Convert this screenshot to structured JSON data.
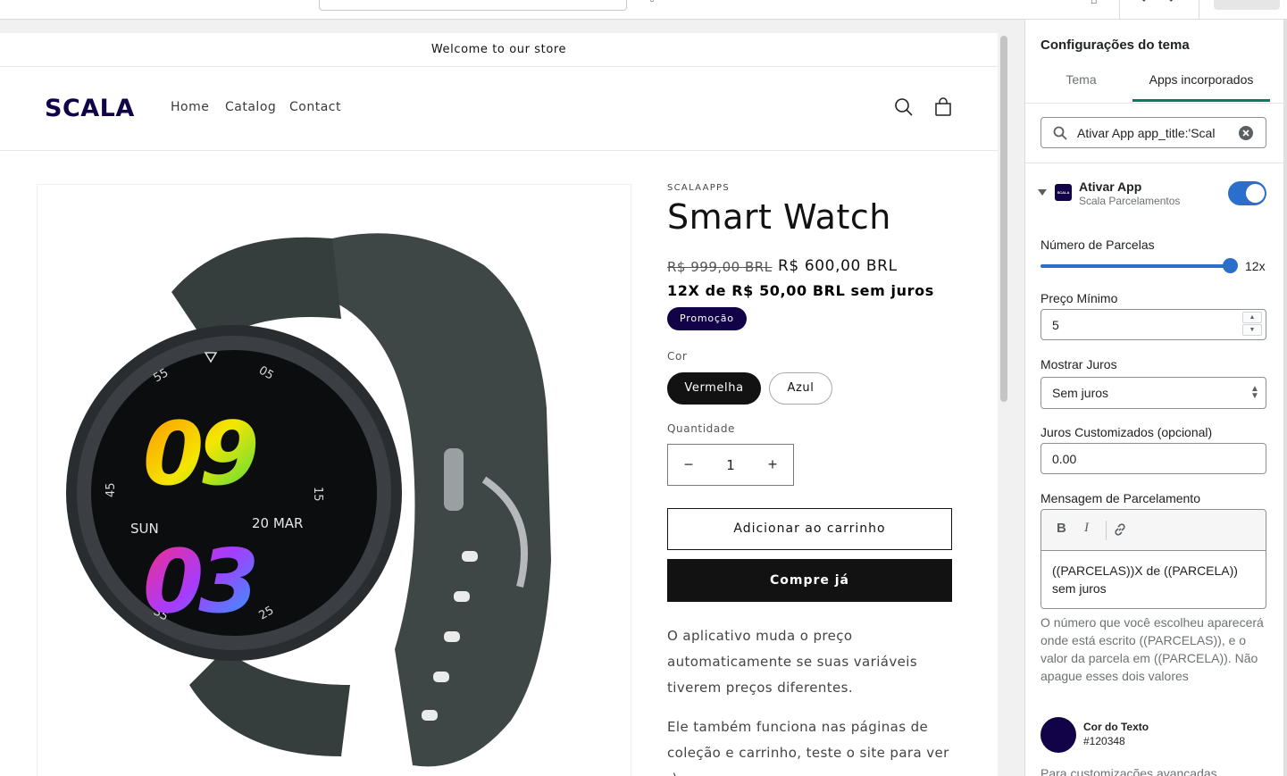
{
  "store": {
    "announcement": "Welcome to our store",
    "logo": "SCALA",
    "nav": [
      "Home",
      "Catalog",
      "Contact"
    ]
  },
  "product": {
    "vendor": "SCALAAPPS",
    "title": "Smart Watch",
    "price_old": "R$ 999,00 BRL",
    "price_new": "R$ 600,00 BRL",
    "installment": "12X de R$ 50,00 BRL sem juros",
    "badge": "Promoção",
    "color_label": "Cor",
    "colors": [
      "Vermelha",
      "Azul"
    ],
    "selected_color": "Vermelha",
    "quantity_label": "Quantidade",
    "quantity": "1",
    "add_to_cart": "Adicionar ao carrinho",
    "buy_now": "Compre já",
    "desc1": "O aplicativo muda o preço automaticamente se suas variáveis tiverem preços diferentes.",
    "desc2": "Ele também funciona nas páginas de coleção e carrinho, teste o site para ver :)",
    "watch_face": {
      "hours": "09",
      "minutes": "03",
      "day": "SUN",
      "date": "20 MAR",
      "dial": [
        "55",
        "05",
        "45",
        "15",
        "35",
        "25"
      ]
    }
  },
  "panel": {
    "title": "Configurações do tema",
    "tabs": [
      "Tema",
      "Apps incorporados"
    ],
    "active_tab": "Apps incorporados",
    "search_value": "Ativar App app_title:'Scal",
    "app": {
      "name": "Ativar App",
      "sub": "Scala Parcelamentos",
      "icon_text": "SCALA",
      "enabled": true
    },
    "parcelas_label": "Número de Parcelas",
    "parcelas_value": "12x",
    "parcelas_fraction": 1.0,
    "preco_label": "Preço Mínimo",
    "preco_value": "5",
    "juros_label": "Mostrar Juros",
    "juros_value": "Sem juros",
    "custom_label": "Juros Customizados (opcional)",
    "custom_value": "0.00",
    "msg_label": "Mensagem de Parcelamento",
    "msg_value": "((PARCELAS))X de ((PARCELA)) sem juros",
    "help": "O número que você escolheu aparecerá onde está escrito ((PARCELAS)), e o valor da parcela em ((PARCELA)). Não apague esses dois valores",
    "color_label": "Cor do Texto",
    "color_value": "#120348",
    "footnote": "Para customizações avançadas"
  },
  "colors": {
    "brand": "#120348",
    "accent_blue": "#2c6ecb",
    "tab_underline": "#008060"
  }
}
